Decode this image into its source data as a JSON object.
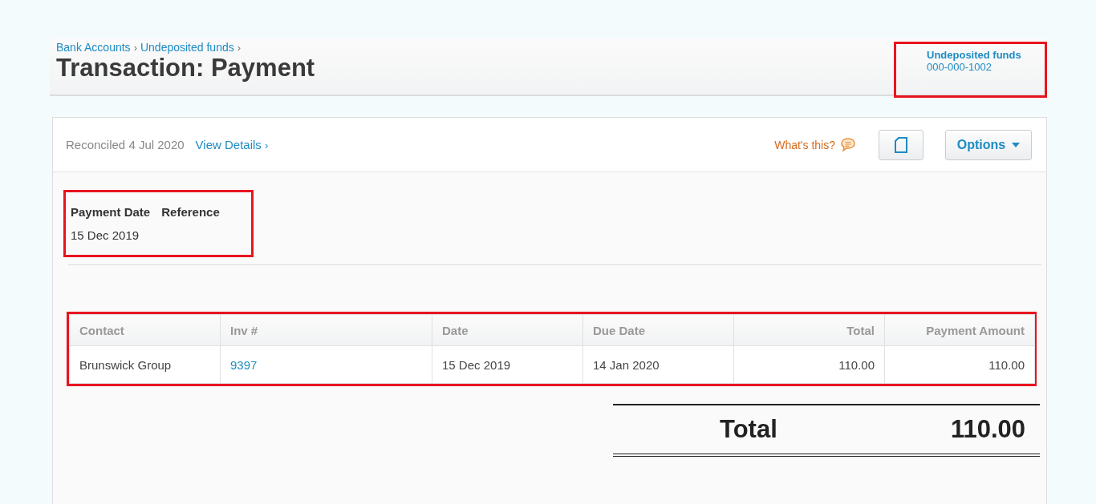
{
  "breadcrumbs": [
    {
      "label": "Bank Accounts",
      "separator": "›"
    },
    {
      "label": "Undeposited funds",
      "separator": "›"
    }
  ],
  "title": "Transaction: Payment",
  "account": {
    "name": "Undeposited funds",
    "number": "000-000-1002"
  },
  "toolbar": {
    "status": "Reconciled 4 Jul 2020",
    "details_link": "View Details",
    "details_chevron": "›",
    "help": "What's this?",
    "options": "Options"
  },
  "details": {
    "labels": [
      "Payment Date",
      "Reference"
    ],
    "values": [
      "15 Dec 2019"
    ]
  },
  "table": {
    "columns": [
      {
        "label": "Contact",
        "kind": "text"
      },
      {
        "label": "Inv #",
        "kind": "text"
      },
      {
        "label": "Date",
        "kind": "date"
      },
      {
        "label": "Due Date",
        "kind": "date"
      },
      {
        "label": "Total",
        "kind": "amount"
      },
      {
        "label": "Payment Amount",
        "kind": "amount"
      }
    ],
    "rows": [
      [
        {
          "text": "Brunswick Group",
          "kind": "text"
        },
        {
          "text": "9397",
          "kind": "link"
        },
        {
          "text": "15 Dec 2019",
          "kind": "text"
        },
        {
          "text": "14 Jan 2020",
          "kind": "text"
        },
        {
          "text": "110.00",
          "kind": "text"
        },
        {
          "text": "110.00",
          "kind": "text"
        }
      ]
    ]
  },
  "total": {
    "label": "Total",
    "amount": "110.00"
  }
}
